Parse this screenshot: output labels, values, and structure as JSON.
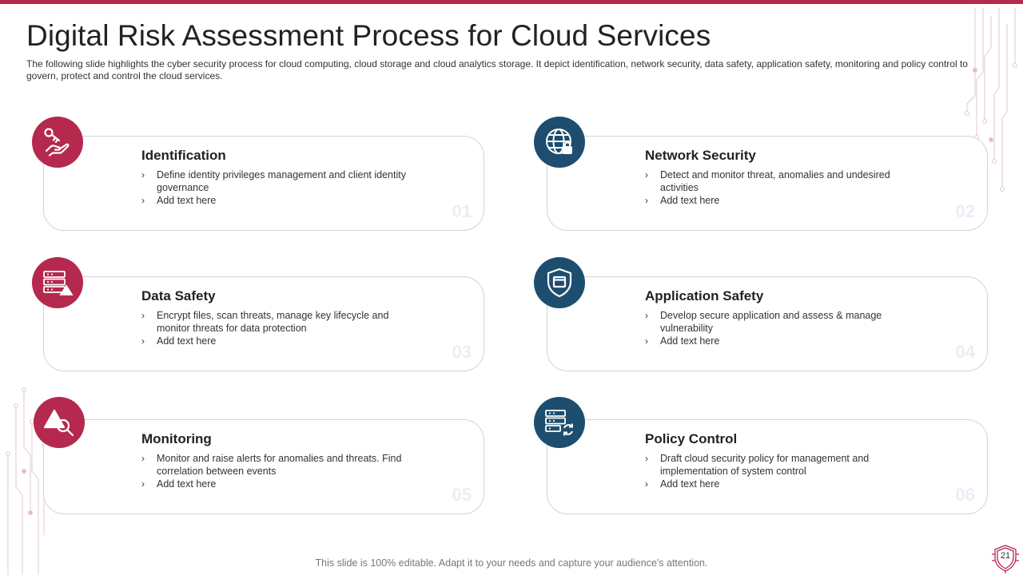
{
  "colors": {
    "accent_red": "#b5294e",
    "accent_blue": "#1d4e6f",
    "top_bar": "#b5294e"
  },
  "slide": {
    "title": "Digital Risk Assessment Process for Cloud Services",
    "subtitle": "The following slide highlights the cyber security process for cloud computing, cloud storage and cloud analytics storage. It depict identification, network security, data safety, application safety, monitoring and policy control to govern, protect and control the cloud services.",
    "footer": "This slide is 100% editable. Adapt it to your needs and capture your audience's attention.",
    "page_number": "21"
  },
  "cards": [
    {
      "icon": "key-hand-icon",
      "title": "Identification",
      "bullets": [
        "Define identity privileges management and client identity governance",
        "Add text here"
      ],
      "number": "01"
    },
    {
      "icon": "globe-lock-icon",
      "title": "Network Security",
      "bullets": [
        "Detect and monitor threat, anomalies and undesired activities",
        "Add text here"
      ],
      "number": "02"
    },
    {
      "icon": "server-warning-icon",
      "title": "Data Safety",
      "bullets": [
        "Encrypt files, scan threats, manage key lifecycle and monitor threats for data protection",
        "Add text here"
      ],
      "number": "03"
    },
    {
      "icon": "shield-window-icon",
      "title": "Application Safety",
      "bullets": [
        "Develop secure application and assess & manage vulnerability",
        "Add text here"
      ],
      "number": "04"
    },
    {
      "icon": "warning-search-icon",
      "title": "Monitoring",
      "bullets": [
        "Monitor and raise alerts for anomalies and threats. Find correlation between events",
        "Add text here"
      ],
      "number": "05"
    },
    {
      "icon": "server-sync-icon",
      "title": "Policy Control",
      "bullets": [
        "Draft cloud security policy for management and implementation of system control",
        "Add text here"
      ],
      "number": "06"
    }
  ]
}
